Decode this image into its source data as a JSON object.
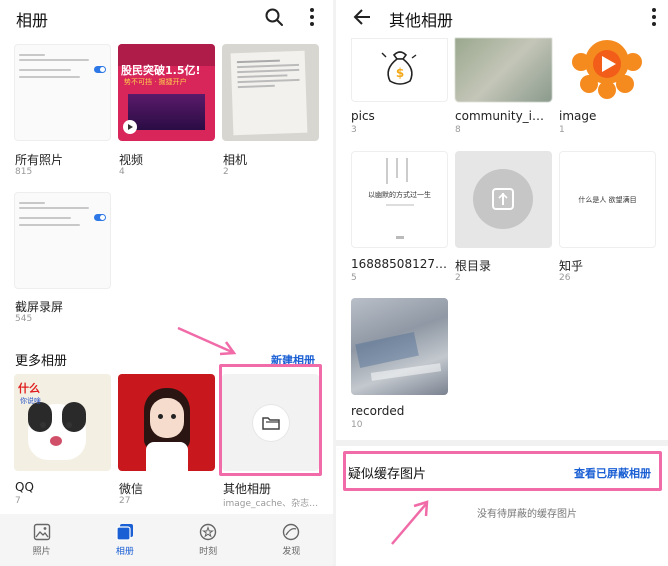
{
  "left": {
    "title": "相册",
    "albums": [
      {
        "name": "所有照片",
        "count": "815"
      },
      {
        "name": "视频",
        "count": "4"
      },
      {
        "name": "相机",
        "count": "2"
      },
      {
        "name": "截屏录屏",
        "count": "545"
      }
    ],
    "video_banner": {
      "main": "股民突破1.5亿!",
      "sub": "势不可挡 · 掘捷开户"
    },
    "more_title": "更多相册",
    "new_album": "新建相册",
    "more_albums": [
      {
        "name": "QQ",
        "count": "7"
      },
      {
        "name": "微信",
        "count": "27"
      },
      {
        "name": "其他相册",
        "count": "image_cache、杂志…"
      }
    ],
    "qq_sticker": {
      "text1": "什么",
      "text2": "你说啥"
    },
    "tabs": [
      {
        "label": "照片"
      },
      {
        "label": "相册"
      },
      {
        "label": "时刻"
      },
      {
        "label": "发现"
      }
    ]
  },
  "right": {
    "title": "其他相册",
    "albums": [
      {
        "name": "pics",
        "count": "3"
      },
      {
        "name": "community_ima...",
        "count": "8"
      },
      {
        "name": "image",
        "count": "1"
      },
      {
        "name": "1688850812735...",
        "count": "5"
      },
      {
        "name": "根目录",
        "count": "2"
      },
      {
        "name": "知乎",
        "count": "26"
      },
      {
        "name": "recorded",
        "count": "10"
      }
    ],
    "book_text": "以幽默的方式过一生",
    "zhihu_text": "什么是人 欲望满目",
    "cache_title": "疑似缓存图片",
    "view_hidden": "查看已屏蔽相册",
    "empty_text": "没有待屏蔽的缓存图片"
  },
  "colors": {
    "accent": "#1a5fd4",
    "highlight": "#f06ba8",
    "video_bg": "#d8265a",
    "wechat_bg": "#c8181e"
  }
}
